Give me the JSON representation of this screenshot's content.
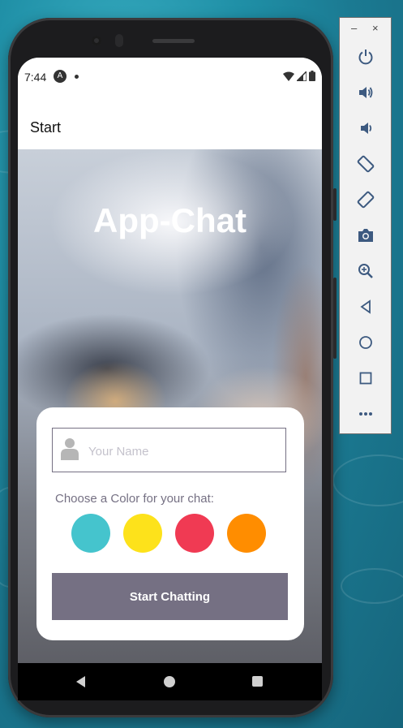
{
  "status_bar": {
    "time": "7:44",
    "notification_icon": "A"
  },
  "app_bar": {
    "title": "Start"
  },
  "hero": {
    "title": "App-Chat"
  },
  "form": {
    "name_placeholder": "Your Name",
    "name_value": "",
    "color_label": "Choose a Color for your chat:",
    "colors": [
      "#45c4cd",
      "#fde21b",
      "#f03a53",
      "#ff8d00"
    ],
    "start_button": "Start Chatting"
  },
  "emulator_toolbar": {
    "minimize": "–",
    "close": "×",
    "buttons": [
      "power-icon",
      "volume-up-icon",
      "volume-down-icon",
      "rotate-left-icon",
      "rotate-right-icon",
      "camera-icon",
      "zoom-icon",
      "back-icon",
      "home-icon",
      "overview-icon",
      "more-icon"
    ]
  },
  "nav_bar": {
    "buttons": [
      "back-icon",
      "home-icon",
      "recents-icon"
    ]
  },
  "colors": {
    "accent": "#757083",
    "background_water": "#1f8fa6"
  }
}
